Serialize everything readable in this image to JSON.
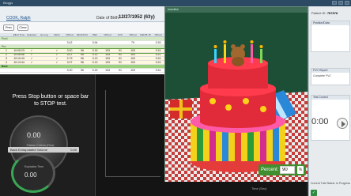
{
  "window": {
    "title": "Bloggs"
  },
  "header": {
    "app_label": "",
    "patient_name": "COOK, Ralph",
    "dob_label": "Date of Birth:",
    "dob_value": "12/27/1952 (63y)"
  },
  "view_tabs": [
    "Prev",
    "Clear"
  ],
  "table": {
    "columns": [
      "",
      "Effort Time",
      "Selected",
      "Ex.Log",
      "FEV1",
      "%Pred",
      "FEV1/FVC",
      "PEF",
      "%Pred",
      "FVC",
      "%Pred",
      "FEF25-75",
      "%Pred"
    ],
    "groups": [
      {
        "label": "Pred",
        "rows": [
          [
            "",
            "",
            "",
            "",
            "",
            "3.42",
            "",
            "3.94",
            "",
            "",
            "79",
            "",
            "2.93"
          ]
        ]
      },
      {
        "label": "Pre",
        "rows": [
          [
            "1",
            "10:05:23",
            "✓",
            "",
            "✓",
            "3.30",
            "96",
            "3.15",
            "133",
            "91",
            "103",
            "",
            "3.24"
          ],
          [
            "2",
            "10:08:56",
            "✓",
            "",
            "✓",
            "3.27",
            "95",
            "3.12",
            "133",
            "91",
            "103",
            "",
            "3.21"
          ],
          [
            "3",
            "10:10:43",
            "✓",
            "",
            "✓",
            "2.79",
            "96",
            "3.13",
            "133",
            "91",
            "103",
            "",
            "3.24"
          ],
          [
            "4",
            "10:13:44",
            "✓",
            "",
            "✓",
            "3.27",
            "96",
            "3.13",
            "133",
            "91",
            "103",
            "",
            "3.24"
          ]
        ]
      },
      {
        "label": "Best",
        "rows": [
          [
            "",
            "",
            "",
            "",
            "",
            "3.30",
            "96",
            "3.15",
            "133",
            "91",
            "103",
            "",
            "3.24"
          ]
        ]
      }
    ]
  },
  "left_panel": {
    "message": "Press Stop button or space bar to STOP test.",
    "gauge_main": {
      "value": "0.00",
      "label": "Plateau Criteria (Flow)"
    },
    "strip": {
      "label": "Back Extrapolated Volume",
      "value": "0.00"
    },
    "gauge_small": {
      "label": "Expiration Time",
      "value": "0.00"
    }
  },
  "plot": {
    "xlabel": "Time (Sec)"
  },
  "cake_window": {
    "title": "Incentive",
    "percent_label": "Percent:",
    "percent_value": "90",
    "percent_unit": "%"
  },
  "side": {
    "patient_id_label": "Patient ID:",
    "patient_id_value": "787878",
    "section1_title": "Position/Data",
    "section2_title": "FVC Report",
    "section2_value": "Complete FVC",
    "section3_title": "Test Control",
    "timer": "0:00",
    "status": "Current Trial Status:",
    "status_value": "In Progress"
  },
  "colors": {
    "green": "#3f8f2f",
    "highlight": "#9bd07b",
    "cake_bg": "#1c4f36"
  }
}
